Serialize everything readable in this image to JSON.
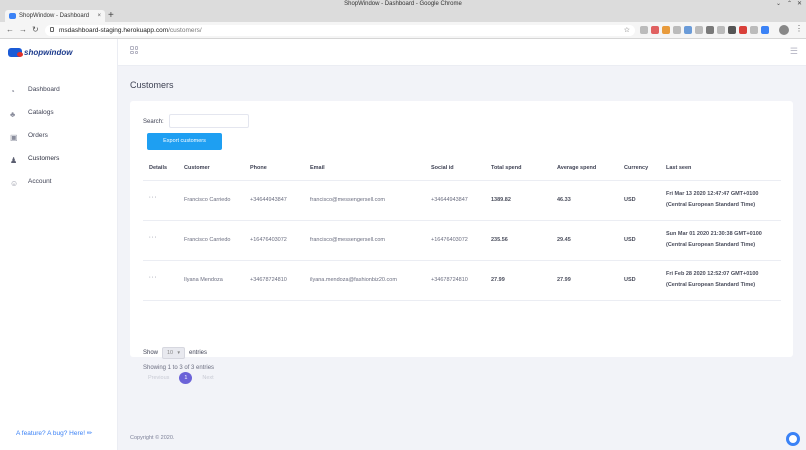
{
  "window": {
    "title": "ShopWindow - Dashboard - Google Chrome"
  },
  "browser": {
    "tab_title": "ShopWindow - Dashboard",
    "tab_close": "×",
    "new_tab": "+",
    "url_host": "msdashboard-staging.herokuapp.com",
    "url_path": "/customers/",
    "back": "←",
    "forward": "→",
    "reload": "↻",
    "bookmark_star": "☆",
    "menu": "⋮"
  },
  "brand": {
    "logo_text": "shopwindow"
  },
  "sidebar": {
    "items": [
      {
        "label": "Dashboard",
        "icon": "speedometer-icon",
        "glyph": "◔"
      },
      {
        "label": "Catalogs",
        "icon": "catalog-icon",
        "glyph": "♣"
      },
      {
        "label": "Orders",
        "icon": "box-icon",
        "glyph": "▣"
      },
      {
        "label": "Customers",
        "icon": "users-icon",
        "glyph": "♟"
      },
      {
        "label": "Account",
        "icon": "user-icon",
        "glyph": "☺"
      }
    ],
    "feedback": "A feature? A bug? Here! ✏"
  },
  "page": {
    "title": "Customers"
  },
  "customers": {
    "search_label": "Search:",
    "search_value": "",
    "export_label": "Export customers",
    "columns": [
      "Details",
      "Customer",
      "Phone",
      "Email",
      "Social id",
      "Total spend",
      "Average spend",
      "Currency",
      "Last seen"
    ],
    "rows": [
      {
        "details": "···",
        "customer": "Francisco Carriedo",
        "phone": "+34644943847",
        "email": "francisco@messengersell.com",
        "social_id": "+34644943847",
        "total": "1389.82",
        "average": "46.33",
        "currency": "USD",
        "last_seen_1": "Fri Mar 13 2020 12:47:47 GMT+0100",
        "last_seen_2": "(Central European Standard Time)"
      },
      {
        "details": "···",
        "customer": "Francisco Carriedo",
        "phone": "+16476403072",
        "email": "francisco@messengersell.com",
        "social_id": "+16476403072",
        "total": "235.56",
        "average": "29.45",
        "currency": "USD",
        "last_seen_1": "Sun Mar 01 2020 21:30:38 GMT+0100",
        "last_seen_2": "(Central European Standard Time)"
      },
      {
        "details": "···",
        "customer": "Ilyana Mendoza",
        "phone": "+34678724810",
        "email": "ilyana.mendoza@fashionbiz20.com",
        "social_id": "+34678724810",
        "total": "27.99",
        "average": "27.99",
        "currency": "USD",
        "last_seen_1": "Fri Feb 28 2020 12:52:07 GMT+0100",
        "last_seen_2": "(Central European Standard Time)"
      }
    ],
    "show_label": "Show",
    "page_length": "10",
    "entries_label": "entries",
    "info": "Showing 1 to 3 of 3 entries",
    "prev": "Previous",
    "current_page": "1",
    "next": "Next"
  },
  "footer": {
    "copyright": "Copyright © 2020."
  },
  "colors": {
    "accent": "#1e9ff2",
    "page_active": "#6c63d8",
    "background": "#f2f3f8"
  }
}
